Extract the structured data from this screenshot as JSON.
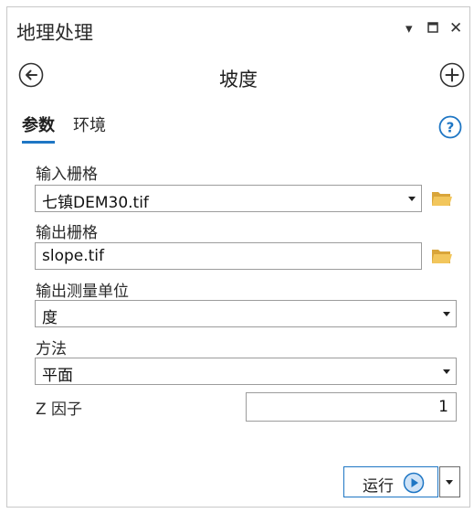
{
  "window": {
    "title": "地理处理",
    "menu_icon": "chevron-down-icon",
    "maximize_icon": "maximize-icon",
    "close_icon": "close-icon"
  },
  "tool": {
    "title": "坡度",
    "back_icon": "back-arrow-icon",
    "add_icon": "add-icon"
  },
  "tabs": [
    {
      "label": "参数",
      "active": true
    },
    {
      "label": "环境",
      "active": false
    }
  ],
  "help_icon": "help-icon",
  "parameters": {
    "input_raster": {
      "label": "输入栅格",
      "value": "七镇DEM30.tif"
    },
    "output_raster": {
      "label": "输出栅格",
      "value": "slope.tif"
    },
    "measurement": {
      "label": "输出测量单位",
      "value": "度"
    },
    "method": {
      "label": "方法",
      "value": "平面"
    },
    "z_factor": {
      "label": "Z 因子",
      "value": "1"
    }
  },
  "run": {
    "label": "运行"
  },
  "colors": {
    "accent": "#1e76c4",
    "folder": "#e8b84a"
  }
}
